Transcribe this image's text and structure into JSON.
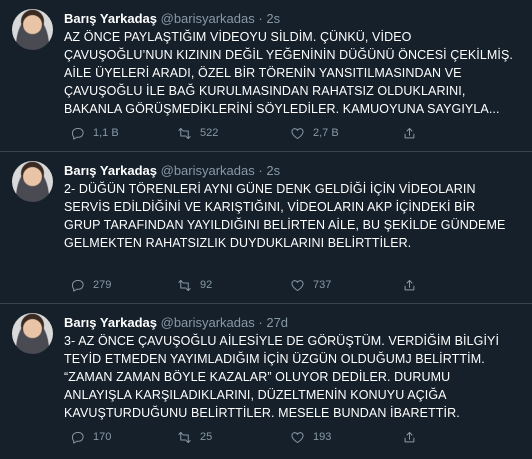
{
  "tweets": [
    {
      "name": "Barış Yarkadaş",
      "handle": "@barisyarkadas",
      "dot": "·",
      "time": "2s",
      "text": "AZ ÖNCE PAYLAŞTIĞIM VİDEOYU SİLDİM. ÇÜNKÜ, VİDEO ÇAVUŞOĞLU’NUN KIZININ DEĞİL YEĞENİNİN DÜĞÜNÜ ÖNCESİ ÇEKİLMİŞ. AİLE ÜYELERİ ARADI, ÖZEL BİR TÖRENİN YANSITILMASINDAN VE ÇAVUŞOĞLU İLE BAĞ KURULMASINDAN RAHATSIZ OLDUKLARINI, BAKANLA GÖRÜŞMEDİKLERİNİ SÖYLEDİLER. KAMUOYUNA SAYGIYLA...",
      "replies": "1,1 B",
      "retweets": "522",
      "likes": "2,7 B"
    },
    {
      "name": "Barış Yarkadaş",
      "handle": "@barisyarkadas",
      "dot": "·",
      "time": "2s",
      "text": "2- DÜĞÜN TÖRENLERİ AYNI GÜNE DENK GELDİĞİ İÇİN VİDEOLARIN SERVİS EDİLDİĞİNİ VE KARIŞTIĞINI, VİDEOLARIN AKP İÇİNDEKİ BİR GRUP TARAFINDAN YAYILDIĞINI BELİRTEN AİLE, BU ŞEKİLDE GÜNDEME GELMEKTEN RAHATSIZLIK DUYDUKLARINI BELİRTTİLER.",
      "replies": "279",
      "retweets": "92",
      "likes": "737"
    },
    {
      "name": "Barış Yarkadaş",
      "handle": "@barisyarkadas",
      "dot": "·",
      "time": "27d",
      "text": "3- AZ ÖNCE ÇAVUŞOĞLU AİLESİYLE DE GÖRÜŞTÜM. VERDİĞİM BİLGİYİ TEYİD ETMEDEN YAYIMLADIĞIM İÇİN ÜZGÜN OLDUĞUMJ BELİRTTİM. “ZAMAN ZAMAN BÖYLE KAZALAR” OLUYOR DEDİLER. DURUMU ANLAYIŞLA KARŞILADIKLARINI, DÜZELTMENİN KONUYU AÇIĞA KAVUŞTURDUĞUNU BELİRTTİLER. MESELE BUNDAN İBARETTİR.",
      "replies": "170",
      "retweets": "25",
      "likes": "193"
    }
  ],
  "colors": {
    "background": "#15202b",
    "divider": "#38444d",
    "muted": "#8899a6",
    "text": "#ffffff"
  },
  "icons": [
    "reply-icon",
    "retweet-icon",
    "like-icon",
    "share-icon"
  ]
}
